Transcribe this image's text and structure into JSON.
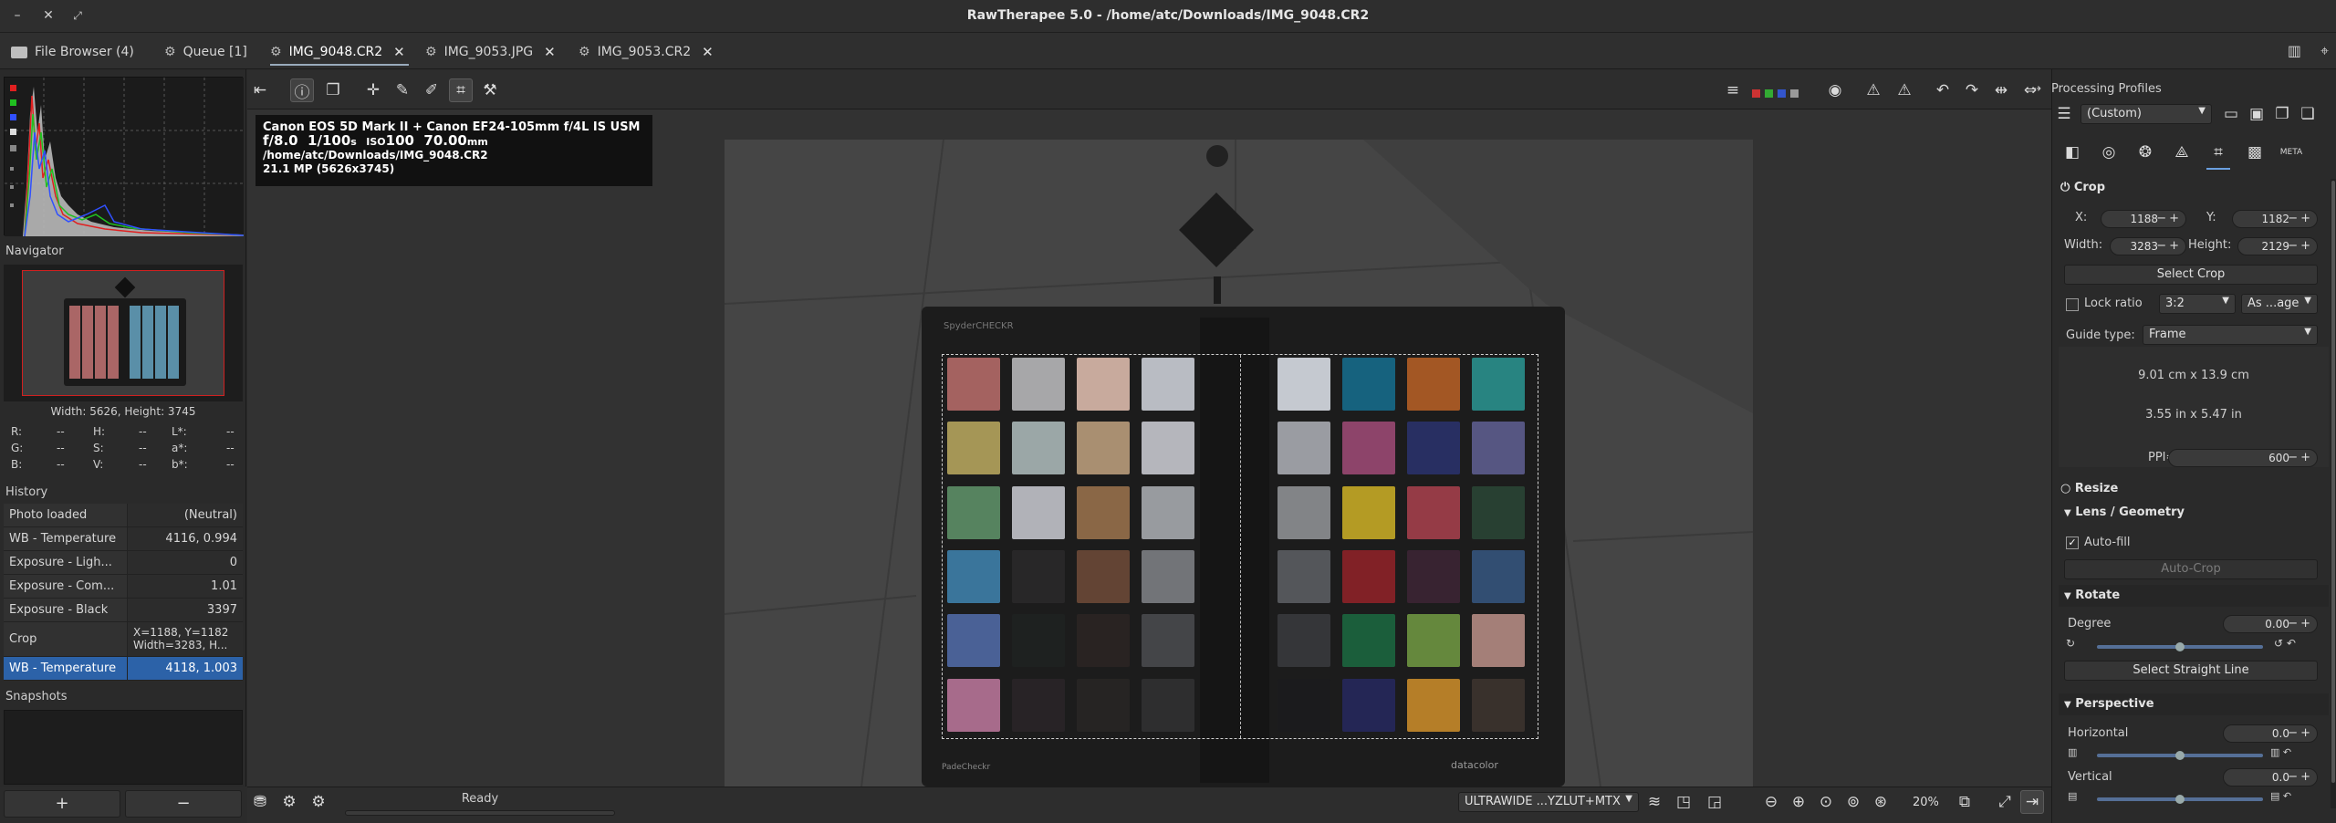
{
  "window": {
    "title": "RawTherapee 5.0 - /home/atc/Downloads/IMG_9048.CR2",
    "minimize_icon": "minus-icon",
    "close_icon": "x-icon"
  },
  "tabs": [
    {
      "label": "File Browser (4)",
      "icon": "folder-icon"
    },
    {
      "label": "Queue [1]",
      "icon": "gears-icon"
    },
    {
      "label": "IMG_9048.CR2",
      "icon": "image-icon"
    },
    {
      "label": "IMG_9053.JPG",
      "icon": "image-icon"
    },
    {
      "label": "IMG_9053.CR2",
      "icon": "image-icon"
    }
  ],
  "left": {
    "navigator_title": "Navigator",
    "size_text": "Width: 5626, Height: 3745",
    "readouts": {
      "r": "R:",
      "r_v": "--",
      "h": "H:",
      "h_v": "--",
      "l": "L*:",
      "l_v": "--",
      "g": "G:",
      "g_v": "--",
      "s": "S:",
      "s_v": "--",
      "a": "a*:",
      "a_v": "--",
      "b": "B:",
      "b_v": "--",
      "v": "V:",
      "v_v": "--",
      "bs": "b*:",
      "bs_v": "--"
    },
    "history_title": "History",
    "history": [
      {
        "name": "Photo loaded",
        "value": "(Neutral)"
      },
      {
        "name": "WB - Temperature",
        "value": "4116, 0.994"
      },
      {
        "name": "Exposure - Ligh...",
        "value": "0"
      },
      {
        "name": "Exposure - Com...",
        "value": "1.01"
      },
      {
        "name": "Exposure - Black",
        "value": "3397"
      },
      {
        "name": "Crop",
        "value": "X=1188, Y=1182",
        "value2": "Width=3283, H..."
      },
      {
        "name": "WB - Temperature",
        "value": "4118, 1.003"
      }
    ],
    "snapshots_title": "Snapshots",
    "add_label": "+",
    "remove_label": "−"
  },
  "exif": {
    "line1": "Canon EOS 5D Mark II + Canon EF24-105mm f/4L IS USM",
    "fnum": "f/8.0",
    "shutter": "1/100",
    "shutter_unit": "s",
    "iso_label": "ISO",
    "iso": "100",
    "focal": "70.00",
    "focal_unit": "mm",
    "path": "/home/atc/Downloads/IMG_9048.CR2",
    "mp": "21.1 MP (5626x3745)"
  },
  "photo": {
    "brand": "SpyderCHECKR",
    "left_patches": [
      "#b26a68",
      "#b6b5b8",
      "#d9b9ab",
      "#c9ccd4",
      "#b3a35e",
      "#a9b5b5",
      "#b89b7b",
      "#c5c6cc",
      "#5e8e67",
      "#c0c2c8",
      "#96704c",
      "#a5a8ad",
      "#3f7fa8",
      "#2b2a2b",
      "#6c4a38",
      "#7c7e82",
      "#5069a3",
      "#212423",
      "#2d2625",
      "#4a4b4e",
      "#b67497",
      "#2b2629",
      "#292726",
      "#323233"
    ],
    "right_patches": [
      "#d6dbe2",
      "#186a89",
      "#b15f27",
      "#2b8f8c",
      "#a7aab0",
      "#994a73",
      "#2c336a",
      "#5d5d8d",
      "#8d8f93",
      "#c4a927",
      "#a2404c",
      "#2b4636",
      "#5b5d62",
      "#8c2429",
      "#3d2635",
      "#36557c",
      "#3a3b3e",
      "#1d6640",
      "#6e9442",
      "#b28a82",
      "#1d1d1f",
      "#27295c",
      "#c5892c",
      "#3e3530"
    ],
    "bottom_left_label": "PadeCheckr",
    "bottom_right_label": "datacolor"
  },
  "status": {
    "ready": "Ready",
    "profile": "ULTRAWIDE ...YZLUT+MTX",
    "zoom": "20%"
  },
  "right": {
    "processing_profiles_label": "Processing Profiles",
    "profile_value": "(Custom)",
    "crop_title": "Crop",
    "x_label": "X:",
    "x_value": "1188",
    "y_label": "Y:",
    "y_value": "1182",
    "width_label": "Width:",
    "width_value": "3283",
    "height_label": "Height:",
    "height_value": "2129",
    "select_crop": "Select Crop",
    "lock_ratio": "Lock ratio",
    "ratio": "3:2",
    "orientation": "As ...age",
    "guide_type_label": "Guide type:",
    "guide_type": "Frame",
    "size_cm": "9.01 cm x 13.9 cm",
    "size_in": "3.55 in x 5.47 in",
    "ppi_label": "PPI=",
    "ppi_value": "600",
    "resize_title": "Resize",
    "lens_title": "Lens / Geometry",
    "autofill_label": "Auto-fill",
    "autocrop_label": "Auto-Crop",
    "rotate_title": "Rotate",
    "degree_label": "Degree",
    "degree_value": "0.00",
    "select_straight": "Select Straight Line",
    "perspective_title": "Perspective",
    "horizontal_label": "Horizontal",
    "horizontal_value": "0.0",
    "vertical_label": "Vertical",
    "vertical_value": "0.0"
  },
  "colors": {
    "accent": "#2c62a8",
    "hist_red": "#e02020",
    "hist_green": "#20c020",
    "hist_blue": "#3050ff"
  }
}
